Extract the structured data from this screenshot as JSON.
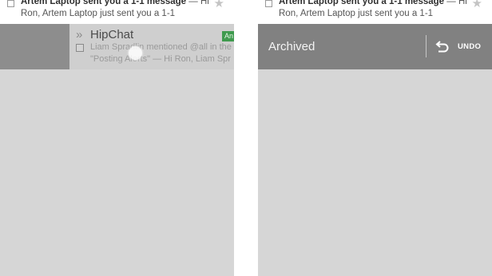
{
  "left_panel": {
    "top_email": {
      "sender_subject": "Artem Laptop sent you a 1-1 message",
      "snippet_tail": " — Hi",
      "snippet_line2": "Ron, Artem Laptop just sent you a 1-1",
      "star_icon": "star-icon"
    },
    "swiped_email": {
      "sender": "HipChat",
      "label": "An",
      "snippet_line1": "Liam Spradlin mentioned @all in the",
      "snippet_line2": "\"Posting Alerts\" — Hi Ron, Liam Spr"
    }
  },
  "right_panel": {
    "top_email": {
      "sender_subject": "Artem Laptop sent you a 1-1 message",
      "snippet_tail": " — Hi",
      "snippet_line2": "Ron, Artem Laptop just sent you a 1-1",
      "star_icon": "star-icon"
    },
    "toast": {
      "message": "Archived",
      "undo_label": "UNDO",
      "undo_icon": "undo-arrow-icon"
    }
  },
  "colors": {
    "list_background": "#d6d6d6",
    "toast_background": "#818181",
    "label_chip": "#3f9a4e"
  }
}
